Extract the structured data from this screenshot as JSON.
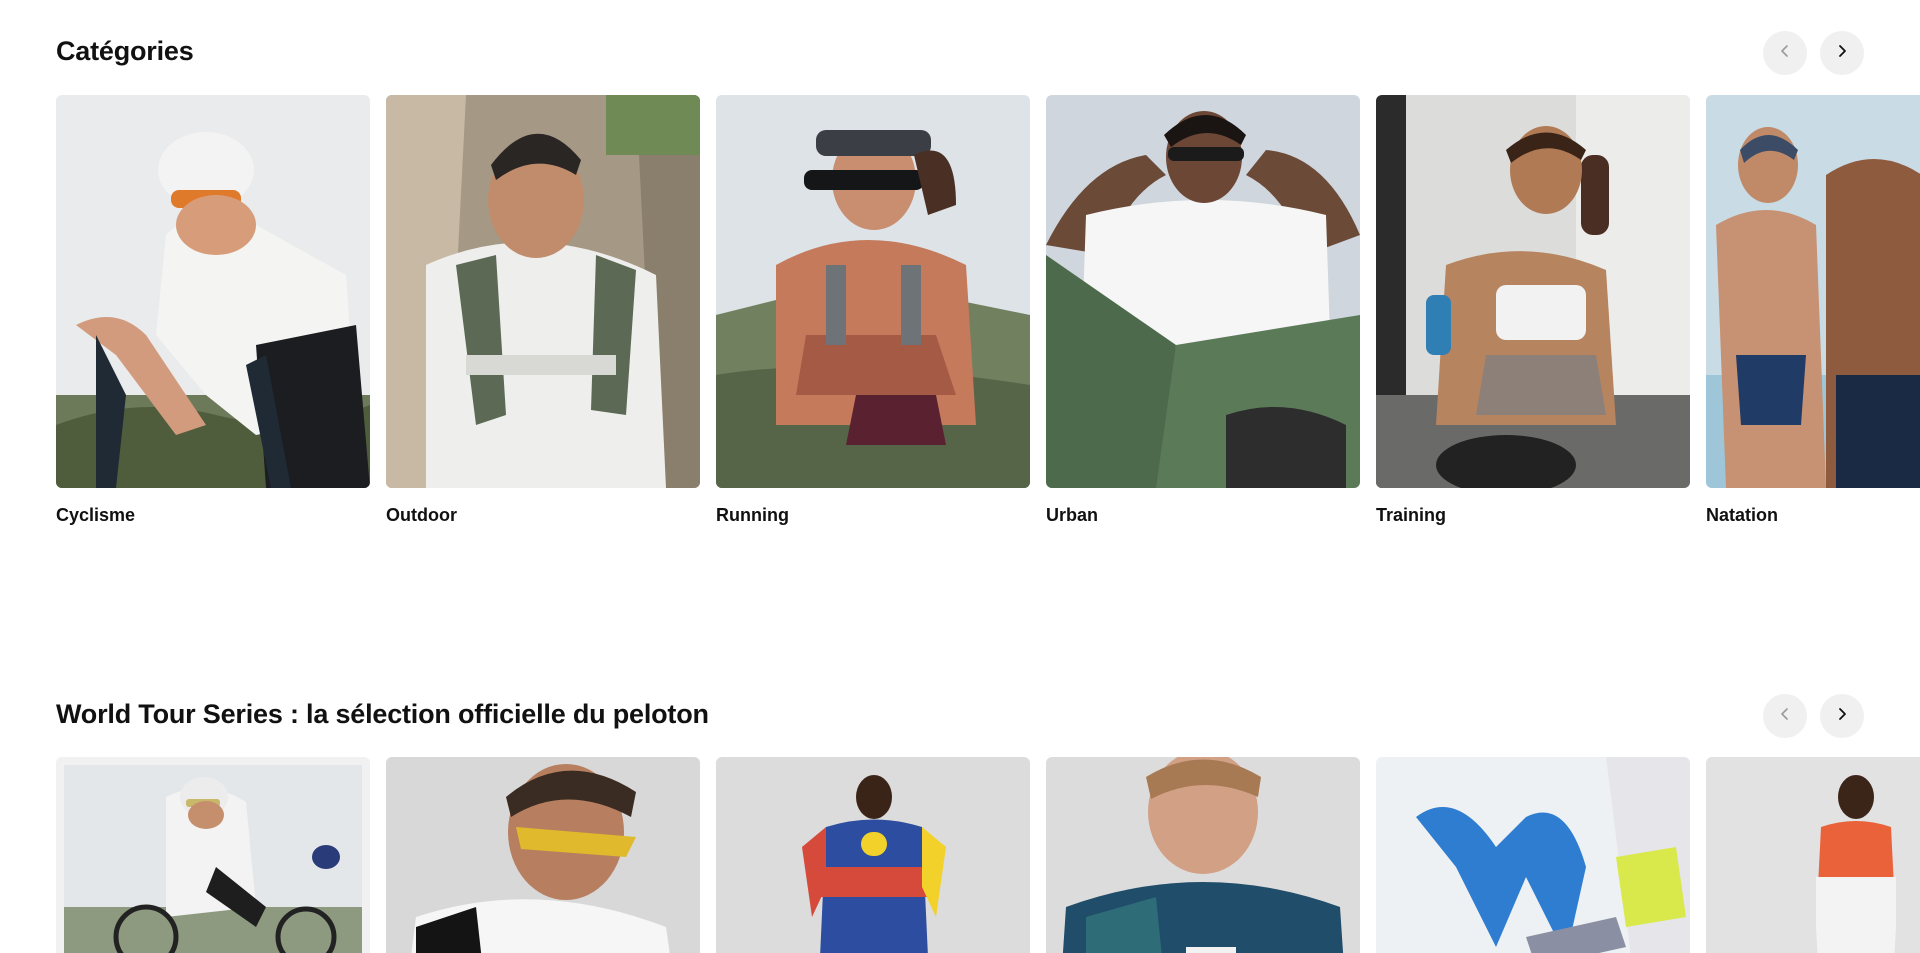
{
  "categories": {
    "title": "Catégories",
    "prev_icon": "chevron-left-icon",
    "next_icon": "chevron-right-icon",
    "items": [
      {
        "label": "Cyclisme"
      },
      {
        "label": "Outdoor"
      },
      {
        "label": "Running"
      },
      {
        "label": "Urban"
      },
      {
        "label": "Training"
      },
      {
        "label": "Natation"
      }
    ]
  },
  "world_tour": {
    "title": "World Tour Series : la sélection officielle du peloton",
    "prev_icon": "chevron-left-icon",
    "next_icon": "chevron-right-icon",
    "items": [
      {
        "image": "team-cyclists-race-photo"
      },
      {
        "image": "cyclist-sunglasses-photo"
      },
      {
        "image": "trek-lidl-jersey-photo"
      },
      {
        "image": "blue-jersey-rider-photo"
      },
      {
        "image": "movistar-jersey-closeup-photo"
      },
      {
        "image": "orange-jersey-rider-photo"
      }
    ]
  },
  "colors": {
    "background": "#ffffff",
    "text": "#111111",
    "nav_button_bg": "#f0f0f0"
  }
}
